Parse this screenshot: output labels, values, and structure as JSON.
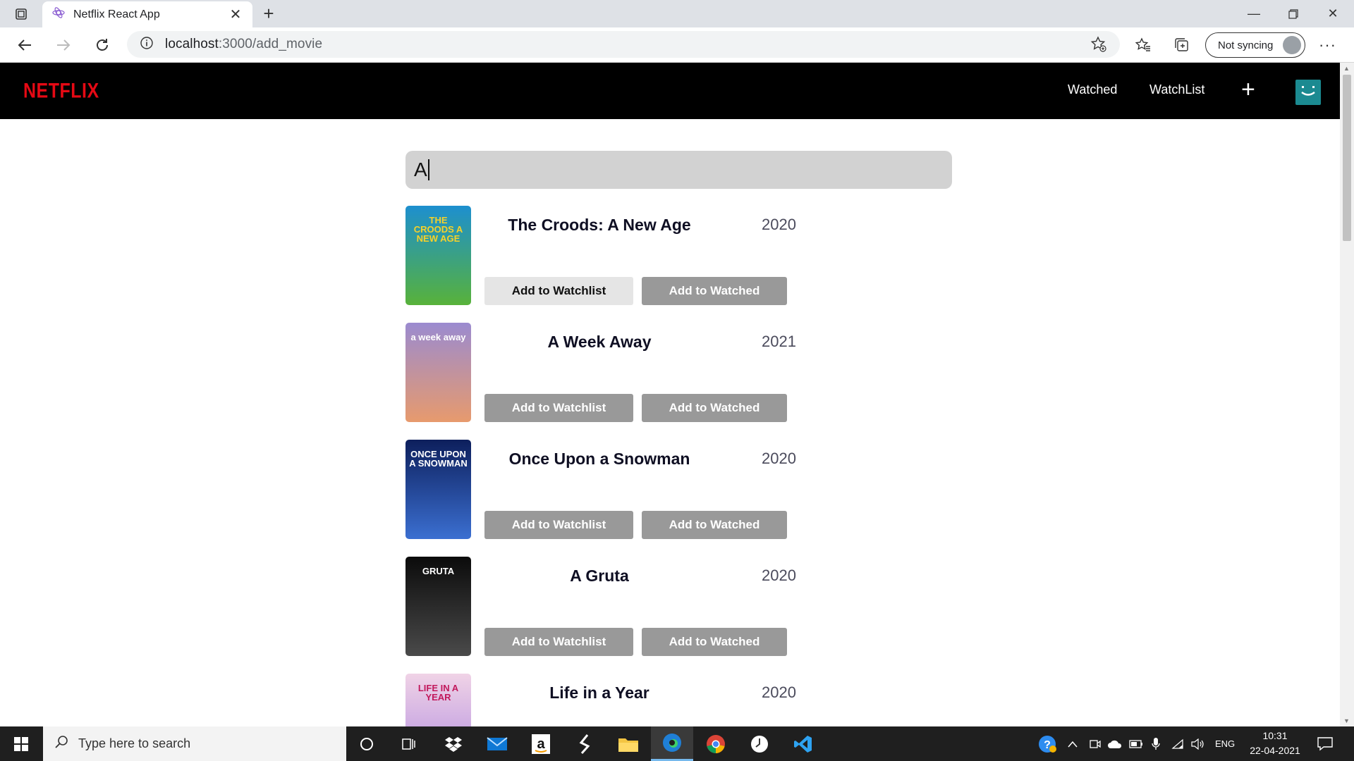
{
  "browser": {
    "tab_title": "Netflix React App",
    "new_tab_symbol": "+",
    "url_host": "localhost",
    "url_path": ":3000/add_movie",
    "sync_label": "Not syncing",
    "more_label": "···"
  },
  "navbar": {
    "logo": "NETFLIX",
    "links": [
      "Watched",
      "WatchList"
    ],
    "add_symbol": "+"
  },
  "search": {
    "value": "A"
  },
  "buttons": {
    "watchlist": "Add to Watchlist",
    "watched": "Add to Watched"
  },
  "movies": [
    {
      "title": "The Croods: A New Age",
      "year": "2020",
      "poster_text": "THE CROODS A NEW AGE",
      "poster_colors": [
        "#1d8fcf",
        "#58b23a"
      ],
      "poster_text_color": "#f6d12a"
    },
    {
      "title": "A Week Away",
      "year": "2021",
      "poster_text": "a week away",
      "poster_colors": [
        "#9b8bd0",
        "#e79a6d"
      ],
      "poster_text_color": "#ffffff"
    },
    {
      "title": "Once Upon a Snowman",
      "year": "2020",
      "poster_text": "ONCE UPON A SNOWMAN",
      "poster_colors": [
        "#0d1f5c",
        "#3b6fd1"
      ],
      "poster_text_color": "#ffffff"
    },
    {
      "title": "A Gruta",
      "year": "2020",
      "poster_text": "GRUTA",
      "poster_colors": [
        "#0b0b0b",
        "#4a4a4a"
      ],
      "poster_text_color": "#ffffff"
    },
    {
      "title": "Life in a Year",
      "year": "2020",
      "poster_text": "LIFE IN A YEAR",
      "poster_colors": [
        "#f0d3e6",
        "#b08be0"
      ],
      "poster_text_color": "#c2185b"
    }
  ],
  "taskbar": {
    "search_placeholder": "Type here to search",
    "lang": "ENG",
    "time": "10:31",
    "date": "22-04-2021"
  }
}
